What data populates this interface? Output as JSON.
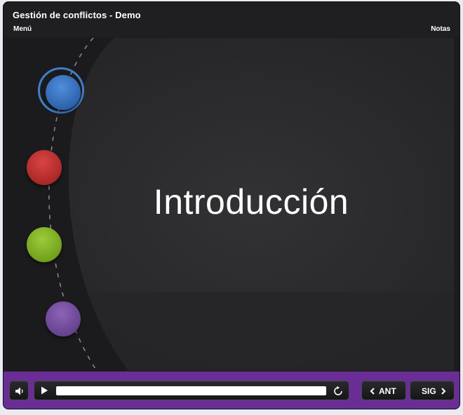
{
  "player": {
    "title": "Gestión de conflictos - Demo",
    "menu_label": "Menú",
    "notes_label": "Notas",
    "accent_color": "#6a2d96"
  },
  "slide": {
    "heading": "Introducción",
    "nav_dots": [
      {
        "name": "blue",
        "color": "#3a74c4",
        "selected": true
      },
      {
        "name": "red",
        "color": "#c53232",
        "selected": false
      },
      {
        "name": "green",
        "color": "#86b52a",
        "selected": false
      },
      {
        "name": "purple",
        "color": "#7650a2",
        "selected": false
      }
    ]
  },
  "controls": {
    "volume_icon": "speaker-icon",
    "play_icon": "play-icon",
    "replay_icon": "replay-icon",
    "progress": 0.0,
    "prev_label": "ANT",
    "next_label": "SIG"
  }
}
